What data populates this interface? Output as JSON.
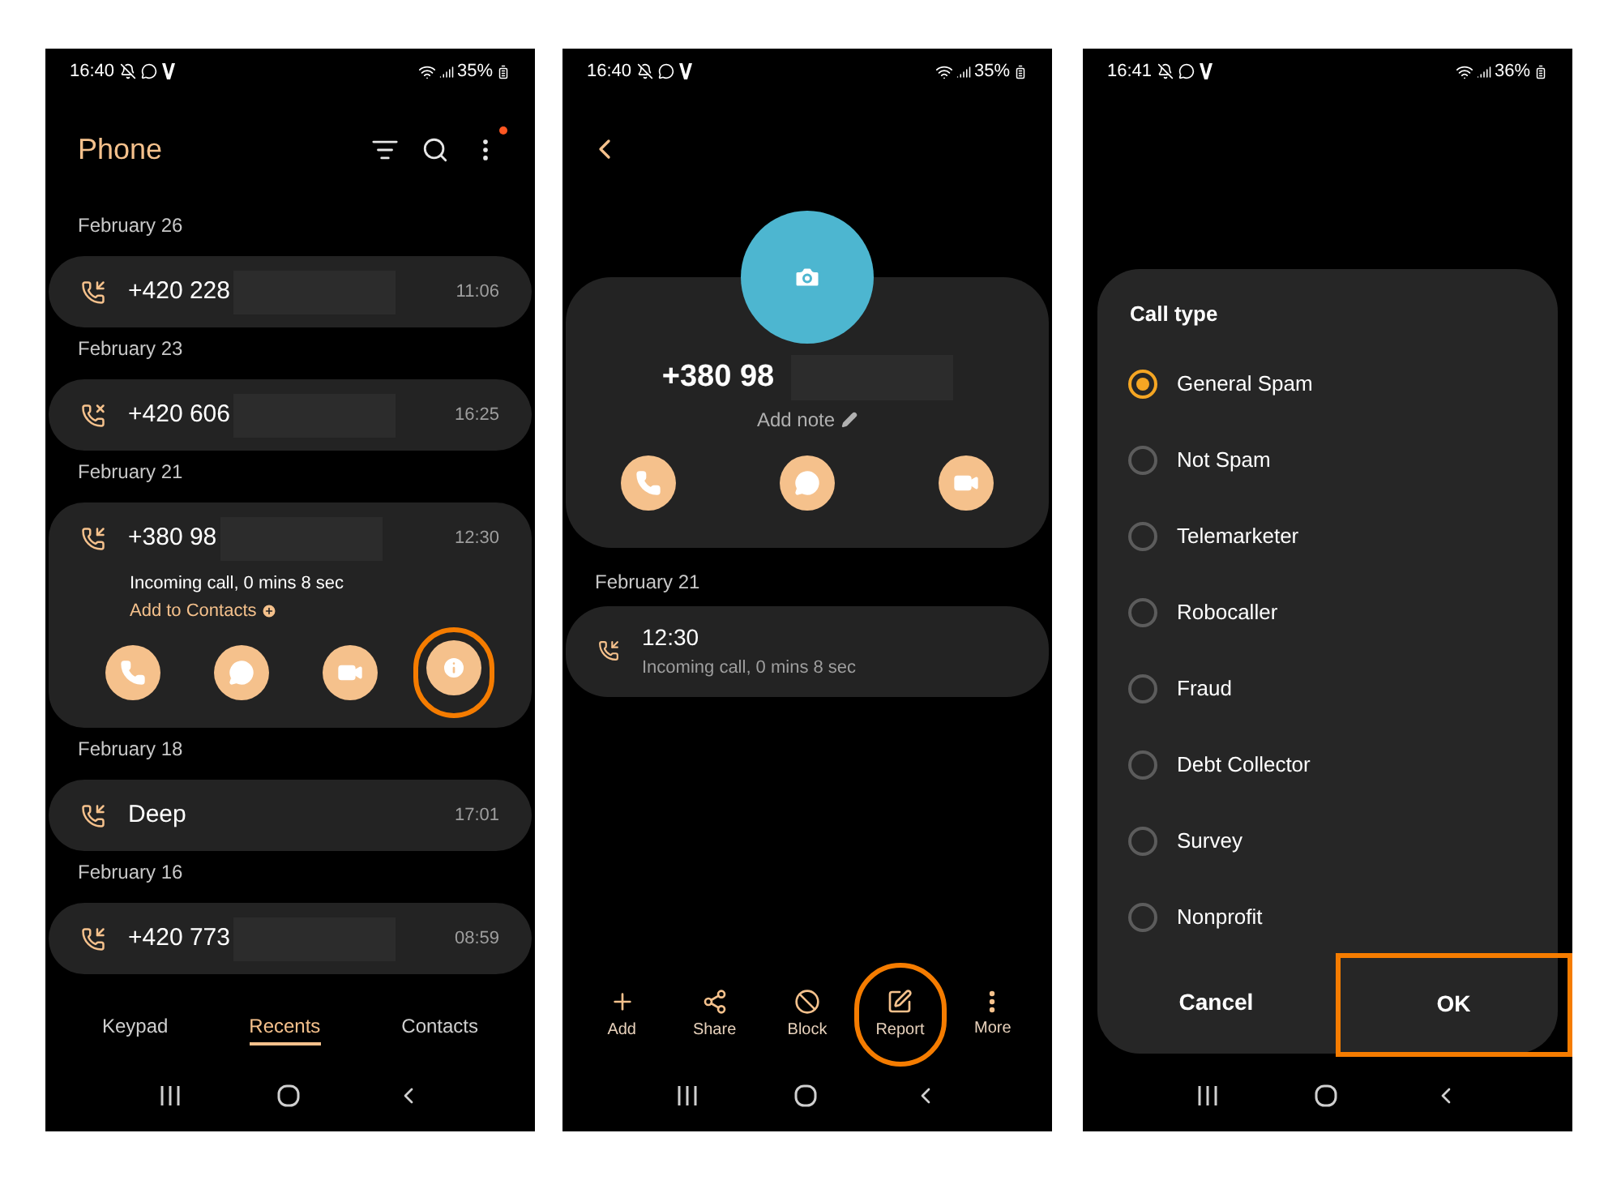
{
  "phones": [
    {
      "kind": "recents",
      "status": {
        "time": "16:40",
        "battery": "35%"
      },
      "title": "Phone",
      "notification": true,
      "groups": [
        {
          "date": "February 26",
          "calls": [
            {
              "name": "+420 228",
              "time": "11:06",
              "kind": "incoming",
              "redacted": true,
              "expanded": false
            }
          ]
        },
        {
          "date": "February 23",
          "calls": [
            {
              "name": "+420 606",
              "time": "16:25",
              "kind": "missed",
              "redacted": true,
              "expanded": false
            }
          ]
        },
        {
          "date": "February 21",
          "calls": [
            {
              "name": "+380 98",
              "time": "12:30",
              "kind": "incoming",
              "redacted": true,
              "expanded": true,
              "detail": "Incoming call, 0 mins 8 sec",
              "link": "Add to Contacts",
              "actions": [
                {
                  "kind": "call",
                  "highlighted": false
                },
                {
                  "kind": "message",
                  "highlighted": false
                },
                {
                  "kind": "video",
                  "highlighted": false
                },
                {
                  "kind": "info",
                  "highlighted": true
                }
              ]
            }
          ]
        },
        {
          "date": "February 18",
          "calls": [
            {
              "name": "Deep",
              "time": "17:01",
              "kind": "incoming",
              "redacted": false,
              "expanded": false
            }
          ]
        },
        {
          "date": "February 16",
          "calls": [
            {
              "name": "+420 773",
              "time": "08:59",
              "kind": "incoming",
              "redacted": true,
              "expanded": false
            }
          ]
        }
      ],
      "tabs": [
        {
          "label": "Keypad",
          "selected": false
        },
        {
          "label": "Recents",
          "selected": true
        },
        {
          "label": "Contacts",
          "selected": false
        }
      ]
    },
    {
      "kind": "details",
      "status": {
        "time": "16:40",
        "battery": "35%"
      },
      "number": "+380 98",
      "redacted": true,
      "note": "Add note",
      "actions": [
        {
          "kind": "call",
          "highlighted": false
        },
        {
          "kind": "message",
          "highlighted": false
        },
        {
          "kind": "video",
          "highlighted": false
        }
      ],
      "date": "February 21",
      "call": {
        "time": "12:30",
        "detail": "Incoming call, 0 mins 8 sec",
        "kind": "incoming"
      },
      "toolbar": [
        {
          "kind": "add",
          "label": "Add",
          "highlighted": false
        },
        {
          "kind": "share",
          "label": "Share",
          "highlighted": false
        },
        {
          "kind": "block",
          "label": "Block",
          "highlighted": false
        },
        {
          "kind": "report",
          "label": "Report",
          "highlighted": true
        },
        {
          "kind": "more",
          "label": "More",
          "highlighted": false
        }
      ]
    },
    {
      "kind": "report",
      "status": {
        "time": "16:41",
        "battery": "36%"
      },
      "dialog": {
        "title": "Call type",
        "options": [
          {
            "label": "General Spam",
            "selected": true
          },
          {
            "label": "Not Spam",
            "selected": false
          },
          {
            "label": "Telemarketer",
            "selected": false
          },
          {
            "label": "Robocaller",
            "selected": false
          },
          {
            "label": "Fraud",
            "selected": false
          },
          {
            "label": "Debt Collector",
            "selected": false
          },
          {
            "label": "Survey",
            "selected": false
          },
          {
            "label": "Nonprofit",
            "selected": false
          }
        ],
        "buttons": [
          {
            "label": "Cancel",
            "highlighted": false
          },
          {
            "label": "OK",
            "highlighted": true
          }
        ]
      }
    }
  ]
}
